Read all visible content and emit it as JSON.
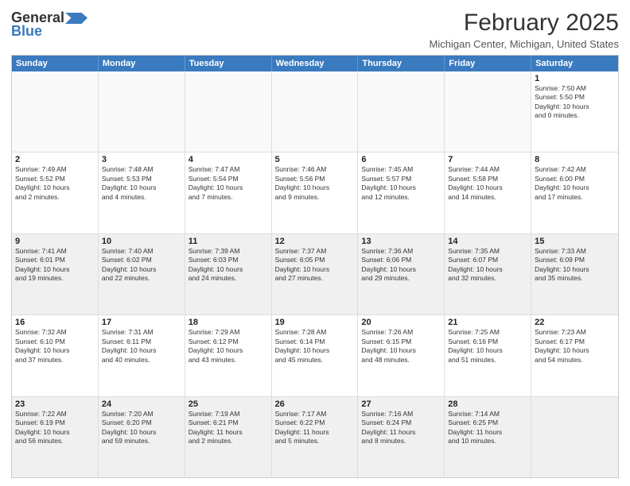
{
  "logo": {
    "part1": "General",
    "part2": "Blue"
  },
  "title": "February 2025",
  "location": "Michigan Center, Michigan, United States",
  "header_days": [
    "Sunday",
    "Monday",
    "Tuesday",
    "Wednesday",
    "Thursday",
    "Friday",
    "Saturday"
  ],
  "rows": [
    [
      {
        "num": "",
        "text": "",
        "empty": true
      },
      {
        "num": "",
        "text": "",
        "empty": true
      },
      {
        "num": "",
        "text": "",
        "empty": true
      },
      {
        "num": "",
        "text": "",
        "empty": true
      },
      {
        "num": "",
        "text": "",
        "empty": true
      },
      {
        "num": "",
        "text": "",
        "empty": true
      },
      {
        "num": "1",
        "text": "Sunrise: 7:50 AM\nSunset: 5:50 PM\nDaylight: 10 hours\nand 0 minutes."
      }
    ],
    [
      {
        "num": "2",
        "text": "Sunrise: 7:49 AM\nSunset: 5:52 PM\nDaylight: 10 hours\nand 2 minutes."
      },
      {
        "num": "3",
        "text": "Sunrise: 7:48 AM\nSunset: 5:53 PM\nDaylight: 10 hours\nand 4 minutes."
      },
      {
        "num": "4",
        "text": "Sunrise: 7:47 AM\nSunset: 5:54 PM\nDaylight: 10 hours\nand 7 minutes."
      },
      {
        "num": "5",
        "text": "Sunrise: 7:46 AM\nSunset: 5:56 PM\nDaylight: 10 hours\nand 9 minutes."
      },
      {
        "num": "6",
        "text": "Sunrise: 7:45 AM\nSunset: 5:57 PM\nDaylight: 10 hours\nand 12 minutes."
      },
      {
        "num": "7",
        "text": "Sunrise: 7:44 AM\nSunset: 5:58 PM\nDaylight: 10 hours\nand 14 minutes."
      },
      {
        "num": "8",
        "text": "Sunrise: 7:42 AM\nSunset: 6:00 PM\nDaylight: 10 hours\nand 17 minutes."
      }
    ],
    [
      {
        "num": "9",
        "text": "Sunrise: 7:41 AM\nSunset: 6:01 PM\nDaylight: 10 hours\nand 19 minutes.",
        "shaded": true
      },
      {
        "num": "10",
        "text": "Sunrise: 7:40 AM\nSunset: 6:02 PM\nDaylight: 10 hours\nand 22 minutes.",
        "shaded": true
      },
      {
        "num": "11",
        "text": "Sunrise: 7:39 AM\nSunset: 6:03 PM\nDaylight: 10 hours\nand 24 minutes.",
        "shaded": true
      },
      {
        "num": "12",
        "text": "Sunrise: 7:37 AM\nSunset: 6:05 PM\nDaylight: 10 hours\nand 27 minutes.",
        "shaded": true
      },
      {
        "num": "13",
        "text": "Sunrise: 7:36 AM\nSunset: 6:06 PM\nDaylight: 10 hours\nand 29 minutes.",
        "shaded": true
      },
      {
        "num": "14",
        "text": "Sunrise: 7:35 AM\nSunset: 6:07 PM\nDaylight: 10 hours\nand 32 minutes.",
        "shaded": true
      },
      {
        "num": "15",
        "text": "Sunrise: 7:33 AM\nSunset: 6:09 PM\nDaylight: 10 hours\nand 35 minutes.",
        "shaded": true
      }
    ],
    [
      {
        "num": "16",
        "text": "Sunrise: 7:32 AM\nSunset: 6:10 PM\nDaylight: 10 hours\nand 37 minutes."
      },
      {
        "num": "17",
        "text": "Sunrise: 7:31 AM\nSunset: 6:11 PM\nDaylight: 10 hours\nand 40 minutes."
      },
      {
        "num": "18",
        "text": "Sunrise: 7:29 AM\nSunset: 6:12 PM\nDaylight: 10 hours\nand 43 minutes."
      },
      {
        "num": "19",
        "text": "Sunrise: 7:28 AM\nSunset: 6:14 PM\nDaylight: 10 hours\nand 45 minutes."
      },
      {
        "num": "20",
        "text": "Sunrise: 7:26 AM\nSunset: 6:15 PM\nDaylight: 10 hours\nand 48 minutes."
      },
      {
        "num": "21",
        "text": "Sunrise: 7:25 AM\nSunset: 6:16 PM\nDaylight: 10 hours\nand 51 minutes."
      },
      {
        "num": "22",
        "text": "Sunrise: 7:23 AM\nSunset: 6:17 PM\nDaylight: 10 hours\nand 54 minutes."
      }
    ],
    [
      {
        "num": "23",
        "text": "Sunrise: 7:22 AM\nSunset: 6:19 PM\nDaylight: 10 hours\nand 56 minutes.",
        "shaded": true
      },
      {
        "num": "24",
        "text": "Sunrise: 7:20 AM\nSunset: 6:20 PM\nDaylight: 10 hours\nand 59 minutes.",
        "shaded": true
      },
      {
        "num": "25",
        "text": "Sunrise: 7:19 AM\nSunset: 6:21 PM\nDaylight: 11 hours\nand 2 minutes.",
        "shaded": true
      },
      {
        "num": "26",
        "text": "Sunrise: 7:17 AM\nSunset: 6:22 PM\nDaylight: 11 hours\nand 5 minutes.",
        "shaded": true
      },
      {
        "num": "27",
        "text": "Sunrise: 7:16 AM\nSunset: 6:24 PM\nDaylight: 11 hours\nand 8 minutes.",
        "shaded": true
      },
      {
        "num": "28",
        "text": "Sunrise: 7:14 AM\nSunset: 6:25 PM\nDaylight: 11 hours\nand 10 minutes.",
        "shaded": true
      },
      {
        "num": "",
        "text": "",
        "empty": true,
        "shaded": true
      }
    ]
  ]
}
